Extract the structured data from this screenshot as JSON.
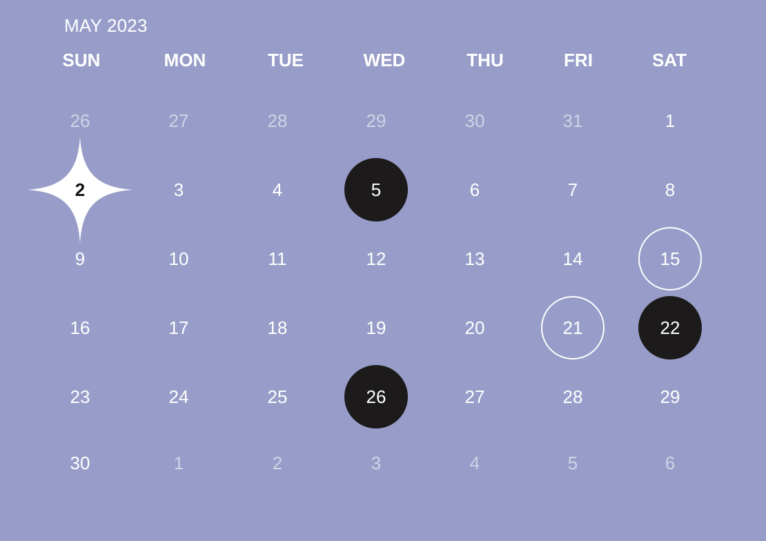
{
  "calendar": {
    "month_label": "MAY 2023",
    "weekdays": [
      "SUN",
      "MON",
      "TUE",
      "WED",
      "THU",
      "FRI",
      "SAT"
    ],
    "weeks": [
      [
        {
          "day": "26",
          "state": "other-month"
        },
        {
          "day": "27",
          "state": "other-month"
        },
        {
          "day": "28",
          "state": "other-month"
        },
        {
          "day": "29",
          "state": "other-month"
        },
        {
          "day": "30",
          "state": "other-month"
        },
        {
          "day": "31",
          "state": "other-month"
        },
        {
          "day": "1",
          "state": "normal"
        }
      ],
      [
        {
          "day": "2",
          "state": "today"
        },
        {
          "day": "3",
          "state": "normal"
        },
        {
          "day": "4",
          "state": "normal"
        },
        {
          "day": "5",
          "state": "filled"
        },
        {
          "day": "6",
          "state": "normal"
        },
        {
          "day": "7",
          "state": "normal"
        },
        {
          "day": "8",
          "state": "normal"
        }
      ],
      [
        {
          "day": "9",
          "state": "normal"
        },
        {
          "day": "10",
          "state": "normal"
        },
        {
          "day": "11",
          "state": "normal"
        },
        {
          "day": "12",
          "state": "normal"
        },
        {
          "day": "13",
          "state": "normal"
        },
        {
          "day": "14",
          "state": "normal"
        },
        {
          "day": "15",
          "state": "outlined"
        }
      ],
      [
        {
          "day": "16",
          "state": "normal"
        },
        {
          "day": "17",
          "state": "normal"
        },
        {
          "day": "18",
          "state": "normal"
        },
        {
          "day": "19",
          "state": "normal"
        },
        {
          "day": "20",
          "state": "normal"
        },
        {
          "day": "21",
          "state": "outlined"
        },
        {
          "day": "22",
          "state": "filled"
        }
      ],
      [
        {
          "day": "23",
          "state": "normal"
        },
        {
          "day": "24",
          "state": "normal"
        },
        {
          "day": "25",
          "state": "normal"
        },
        {
          "day": "26",
          "state": "filled"
        },
        {
          "day": "27",
          "state": "normal"
        },
        {
          "day": "28",
          "state": "normal"
        },
        {
          "day": "29",
          "state": "normal"
        }
      ],
      [
        {
          "day": "30",
          "state": "normal"
        },
        {
          "day": "1",
          "state": "other-month"
        },
        {
          "day": "2",
          "state": "other-month"
        },
        {
          "day": "3",
          "state": "other-month"
        },
        {
          "day": "4",
          "state": "other-month"
        },
        {
          "day": "5",
          "state": "other-month"
        },
        {
          "day": "6",
          "state": "other-month"
        }
      ]
    ]
  },
  "theme": {
    "background": "#979dc8",
    "text": "#ffffff",
    "filled_marker": "#1c1a1a",
    "today_marker": "#ffffff"
  },
  "icons": {
    "today_marker": "four-point-star-icon"
  }
}
